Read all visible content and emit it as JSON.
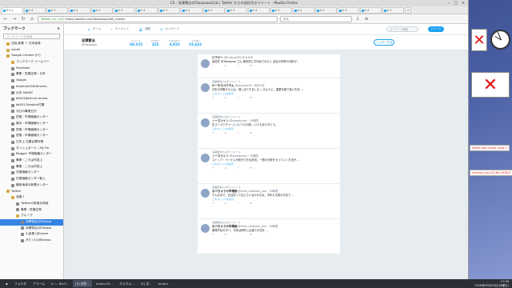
{
  "window": {
    "title": "CS - 深澤賢治のTakazawa(2)& | Twitter からの返信付きツイート - Mozilla Firefox"
  },
  "tabs": [
    {
      "label": "ツイッ"
    },
    {
      "label": "ツイ"
    },
    {
      "label": "ツイ"
    },
    {
      "label": "ツイ"
    },
    {
      "label": "ツイ"
    },
    {
      "label": "ツイ"
    },
    {
      "label": "ツイ"
    },
    {
      "label": "ツイ"
    },
    {
      "label": "ツイ"
    },
    {
      "label": "ツイ"
    },
    {
      "label": "ツイ"
    },
    {
      "label": "ツイ"
    },
    {
      "label": "ツイ"
    },
    {
      "label": "ツイ"
    },
    {
      "label": "ツイ"
    },
    {
      "label": "ツイ"
    },
    {
      "label": "ツイ"
    },
    {
      "label": "ツイ"
    },
    {
      "label": "+"
    }
  ],
  "navbar": {
    "url": "https://twitter.com/Takazawa/with_replies",
    "site_label": "Twitter, Inc. (US)",
    "search_placeholder": "検索"
  },
  "sidebar": {
    "title": "ブックマーク",
    "search_placeholder": "ブックマークを検索",
    "items": [
      {
        "label": "日経 新着 ー 日本経済"
      },
      {
        "label": "vstrell"
      },
      {
        "label": "Google Chrome から"
      },
      {
        "label": "ブックマーク ツールバー"
      },
      {
        "label": "Facebook"
      },
      {
        "label": "事業・危機生物・日本"
      },
      {
        "label": "Google"
      },
      {
        "label": "fenomo2018/fenomo"
      },
      {
        "label": "日本 SMART"
      },
      {
        "label": "bb2018/ishi-ei-aruma"
      },
      {
        "label": "bb2017/project付書"
      },
      {
        "label": "今日の事業日付"
      },
      {
        "label": "危険・市場価格センター"
      },
      {
        "label": "東京・市場価格センター"
      },
      {
        "label": "危険・市場価格センター"
      },
      {
        "label": "危険・市場価格センター"
      },
      {
        "label": "日本上 白書目標対策"
      },
      {
        "label": "ダッシュボード - My Fin"
      },
      {
        "label": "Blogger 市場価格センター"
      },
      {
        "label": "事業・ころは作成上"
      },
      {
        "label": "事業・ころは作成上"
      },
      {
        "label": "外国価格センター"
      },
      {
        "label": "外国価格センター取入"
      },
      {
        "label": "最新地域の新着センター"
      },
      {
        "label": "Twitter"
      },
      {
        "label": "言議 1"
      },
      {
        "label": "Twitterの真面な検索"
      },
      {
        "label": "事業・危機生物"
      },
      {
        "label": "グループ"
      },
      {
        "label": "深澤賢治(@Takaza"
      },
      {
        "label": "深澤賢治(@Takaza"
      },
      {
        "label": "小倉雪 (@iwane"
      },
      {
        "label": "ぎたソロ(@teraso"
      }
    ]
  },
  "twitter": {
    "nav": [
      "ホーム",
      "モーメント",
      "通知",
      "メッセージ"
    ],
    "search_placeholder": "キーワード検索",
    "tweet_btn": "ツイート"
  },
  "profile": {
    "name": "深澤賢治",
    "handle": "@Takazawa",
    "stats": [
      {
        "label": "ツイート",
        "value": "69,515"
      },
      {
        "label": "フォロー",
        "value": "422"
      },
      {
        "label": "フォロワー",
        "value": "4,932"
      },
      {
        "label": "いいね",
        "value": "33,422"
      }
    ],
    "follow_btn": "フォローする"
  },
  "tweets": [
    {
      "rt": "",
      "name": "ピクピー",
      "handle": "@CulturalPSCHOLESS",
      "text": "返信先 @Takazawa さん 基本的に平均化されたと 会社の世界の分析が…",
      "sub": "",
      "link": ""
    },
    {
      "rt": "深澤賢治さんがリツイート",
      "name": "けーやスペクラム",
      "handle": "@jaymonth8 · 8月29日",
      "text": "日本の宗教からとは、常に出てきました.このように、農業を取り扱い方法 …",
      "sub": "",
      "link": "このスレッドを表示"
    },
    {
      "rt": "深澤賢治さんがリツイート",
      "name": "ノースツイン",
      "handle": "@snowbunes · 29時間",
      "text": "石ストラクチャーについての分析。いつもありがとう。",
      "sub": "",
      "link": "このスレッドを表示"
    },
    {
      "rt": "深澤賢治さんがリツイート",
      "name": "ノースツイン",
      "handle": "@snowbunes · 29時間",
      "text": "ストップ・ベトナム分析ができる状況。一般の分析をもっていく方法が …",
      "sub": "",
      "link": "このスレッドを表示"
    },
    {
      "rt": "深澤賢治さんがリツイート",
      "name": "なべちゃう@市場価",
      "handle": "@mike_nabetaro_jazz · 30時間",
      "text": "そんな中で、元住宅って住んでいるのかなぁ。今年も平成の方法で …",
      "sub": "",
      "link": "このスレッドを表示"
    },
    {
      "rt": "深澤賢治さんがリツイート",
      "name": "なべちゃう@市場価",
      "handle": "@mike_nabetaro_jazz · 30時間",
      "text": "管理不足の方へ、今年は例年とは違う方法を …",
      "sub": "",
      "link": ""
    }
  ],
  "widgets": {
    "label1": "tweet-add-mysql-cong-F",
    "label2": "memory-wg-2018e-2018(V"
  },
  "taskbar": {
    "apps": [
      "フォルダ",
      "アラーム",
      "In — Bd:S...",
      "[S] 検索...",
      "emacs25...",
      "カスタム...",
      "[S] 深...",
      "emacs"
    ],
    "clock_time": "17:56",
    "clock_date": "2018年09月24日(月曜日)"
  }
}
